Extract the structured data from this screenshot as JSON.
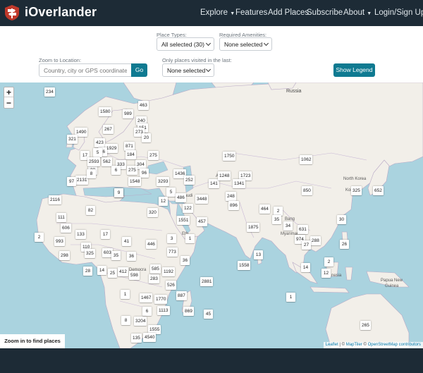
{
  "brand": {
    "name": "iOverlander",
    "logo_icon": "signpost-logo-icon",
    "logo_color": "#c0392b"
  },
  "nav": {
    "explore": "Explore",
    "features": "Features",
    "add_places": "Add Places",
    "subscribe": "Subscribe",
    "about": "About",
    "login": "Login/Sign Up"
  },
  "filters": {
    "place_types_label": "Place Types:",
    "place_types_value": "All selected (30)",
    "amenities_label": "Required Amenities:",
    "amenities_value": "None selected",
    "zoom_label": "Zoom to Location:",
    "zoom_placeholder": "Country, city or GPS coordinates",
    "go_label": "Go",
    "visited_label": "Only places visited in the last:",
    "visited_value": "None selected",
    "legend_button": "Show Legend"
  },
  "map": {
    "zoom_in": "+",
    "zoom_out": "−",
    "zoom_hint": "Zoom in to find places",
    "attribution": {
      "leaflet": "Leaflet",
      "sep": " | © ",
      "maptiler": "MapTiler",
      "mid": " © ",
      "osm": "OpenStreetMap contributors"
    },
    "colors": {
      "water": "#aad3df",
      "land": "#f2efe9",
      "border": "#b9a9c6",
      "accent": "#0f7a91"
    },
    "labels": [
      {
        "text": "Russia",
        "big": true
      },
      {
        "text": "North Korea",
        "big": false
      },
      {
        "text": "Korea",
        "big": false
      },
      {
        "text": "Saudi",
        "big": false
      },
      {
        "text": "Myanmar",
        "big": false
      },
      {
        "text": "Eth",
        "big": false
      },
      {
        "text": "Democra",
        "big": false
      },
      {
        "text": "nesia",
        "big": false
      },
      {
        "text": "Papua New",
        "big": false
      },
      {
        "text": "Guinea",
        "big": false
      },
      {
        "text": "Afg",
        "big": false
      },
      {
        "text": "Bang",
        "big": false
      }
    ],
    "markers": [
      "234",
      "1580",
      "989",
      "463",
      "240",
      "151",
      "267",
      "273",
      "1490",
      "321",
      "423",
      "1929",
      "871",
      "20",
      "26",
      "17",
      "28",
      "5",
      "275",
      "184",
      "2593",
      "562",
      "333",
      "304",
      "2131",
      "6",
      "97",
      "275",
      "96",
      "8",
      "1548",
      "2116",
      "29",
      "5",
      "3293",
      "486",
      "1436",
      "252",
      "1750",
      "1062",
      "141",
      "1248",
      "1723",
      "1341",
      "248",
      "3448",
      "896",
      "12",
      "9",
      "122",
      "850",
      "325",
      "652",
      "1551",
      "457",
      "464",
      "2",
      "35",
      "34",
      "631",
      "30",
      "82",
      "17",
      "320",
      "1875",
      "111",
      "606",
      "133",
      "2",
      "993",
      "110",
      "298",
      "325",
      "603",
      "35",
      "446",
      "773",
      "3",
      "1",
      "13",
      "974",
      "288",
      "27",
      "36",
      "41",
      "36",
      "26",
      "28",
      "14",
      "25",
      "412",
      "585",
      "1192",
      "1558",
      "2",
      "14",
      "12",
      "598",
      "283",
      "526",
      "2881",
      "1",
      "1467",
      "1770",
      "887",
      "1",
      "6",
      "1113",
      "869",
      "45",
      "8",
      "3204",
      "1555",
      "135",
      "4540",
      "265",
      "2238"
    ]
  }
}
